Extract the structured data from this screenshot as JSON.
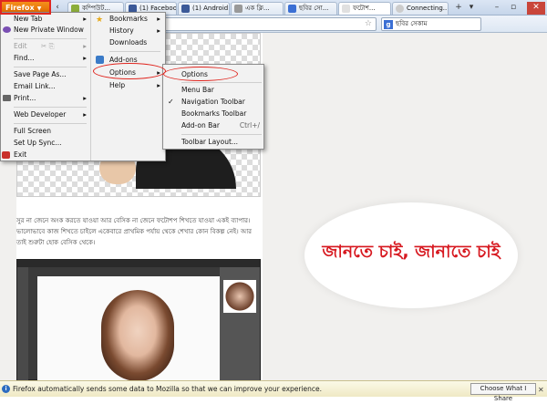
{
  "titlebar": {
    "app_button": "Firefox",
    "tabs": [
      {
        "label": "কম্পিউট...",
        "color": "#8cae3a"
      },
      {
        "label": "(1) Facebook",
        "color": "#3b5998"
      },
      {
        "label": "(1) Android ...",
        "color": "#3b5998"
      },
      {
        "label": "এক ক্লি...",
        "color": "#999999"
      },
      {
        "label": "ছবির সো...",
        "color": "#3b6fd4"
      },
      {
        "label": "ফটোশ...",
        "color": "#e0e0e0"
      },
      {
        "label": "Connecting...",
        "color": "#cccccc"
      }
    ],
    "new_tab": "+",
    "back_icon": "‹",
    "list_icon": "▾",
    "minimize": "–",
    "restore": "▫",
    "close": "✕"
  },
  "navbar": {
    "star": "☆",
    "search_engine": "g",
    "search_value": "ছবির সেকাম"
  },
  "page": {
    "paragraph": "সুর না জেনে অংক করতে যাওয়া আর বেসিক না জেনে ফটোশপ শিখতে যাওয়া একই ব্যাপার। ভালোভাবে কাজ শিখতে চাইলে একেবারে প্রাথমিক পর্যায় থেকে শেখার কোন বিকল্প নেই। আর তাই শুরুটা হোক বেসিক থেকে।",
    "slogan": "জানতে চাই, জানাতে চাই"
  },
  "firefox_menu": {
    "col1": [
      {
        "label": "New Tab",
        "arrow": "▸"
      },
      {
        "label": "New Private Window"
      },
      {
        "label": "Edit",
        "arrow": "▸"
      },
      {
        "label": "Find...",
        "arrow": "▸"
      },
      {
        "label": "Save Page As..."
      },
      {
        "label": "Email Link..."
      },
      {
        "label": "Print...",
        "arrow": "▸"
      },
      {
        "label": "Web Developer",
        "arrow": "▸"
      },
      {
        "label": "Full Screen"
      },
      {
        "label": "Set Up Sync..."
      },
      {
        "label": "Exit"
      }
    ],
    "col2": [
      {
        "label": "Bookmarks",
        "arrow": "▸"
      },
      {
        "label": "History",
        "arrow": "▸"
      },
      {
        "label": "Downloads"
      },
      {
        "label": "Add-ons"
      },
      {
        "label": "Options",
        "arrow": "▸"
      },
      {
        "label": "Help",
        "arrow": "▸"
      }
    ]
  },
  "options_submenu": [
    {
      "label": "Options"
    },
    {
      "label": "Menu Bar"
    },
    {
      "label": "Navigation Toolbar",
      "check": "✓"
    },
    {
      "label": "Bookmarks Toolbar"
    },
    {
      "label": "Add-on Bar",
      "shortcut": "Ctrl+/"
    },
    {
      "label": "Toolbar Layout..."
    }
  ],
  "notification": {
    "info_icon": "i",
    "message": "Firefox automatically sends some data to Mozilla so that we can improve your experience.",
    "button": "Choose What I Share",
    "close": "✕"
  }
}
